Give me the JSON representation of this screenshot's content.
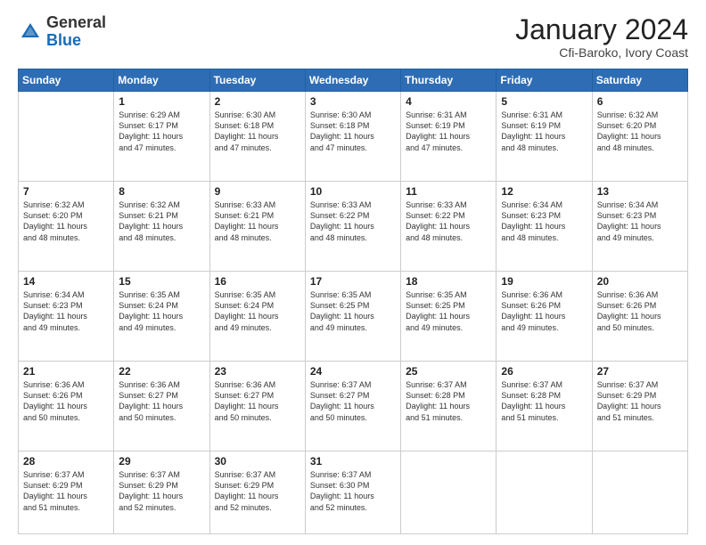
{
  "header": {
    "logo_general": "General",
    "logo_blue": "Blue",
    "month_title": "January 2024",
    "subtitle": "Cfi-Baroko, Ivory Coast"
  },
  "weekdays": [
    "Sunday",
    "Monday",
    "Tuesday",
    "Wednesday",
    "Thursday",
    "Friday",
    "Saturday"
  ],
  "weeks": [
    [
      {
        "day": "",
        "info": ""
      },
      {
        "day": "1",
        "info": "Sunrise: 6:29 AM\nSunset: 6:17 PM\nDaylight: 11 hours\nand 47 minutes."
      },
      {
        "day": "2",
        "info": "Sunrise: 6:30 AM\nSunset: 6:18 PM\nDaylight: 11 hours\nand 47 minutes."
      },
      {
        "day": "3",
        "info": "Sunrise: 6:30 AM\nSunset: 6:18 PM\nDaylight: 11 hours\nand 47 minutes."
      },
      {
        "day": "4",
        "info": "Sunrise: 6:31 AM\nSunset: 6:19 PM\nDaylight: 11 hours\nand 47 minutes."
      },
      {
        "day": "5",
        "info": "Sunrise: 6:31 AM\nSunset: 6:19 PM\nDaylight: 11 hours\nand 48 minutes."
      },
      {
        "day": "6",
        "info": "Sunrise: 6:32 AM\nSunset: 6:20 PM\nDaylight: 11 hours\nand 48 minutes."
      }
    ],
    [
      {
        "day": "7",
        "info": "Sunrise: 6:32 AM\nSunset: 6:20 PM\nDaylight: 11 hours\nand 48 minutes."
      },
      {
        "day": "8",
        "info": "Sunrise: 6:32 AM\nSunset: 6:21 PM\nDaylight: 11 hours\nand 48 minutes."
      },
      {
        "day": "9",
        "info": "Sunrise: 6:33 AM\nSunset: 6:21 PM\nDaylight: 11 hours\nand 48 minutes."
      },
      {
        "day": "10",
        "info": "Sunrise: 6:33 AM\nSunset: 6:22 PM\nDaylight: 11 hours\nand 48 minutes."
      },
      {
        "day": "11",
        "info": "Sunrise: 6:33 AM\nSunset: 6:22 PM\nDaylight: 11 hours\nand 48 minutes."
      },
      {
        "day": "12",
        "info": "Sunrise: 6:34 AM\nSunset: 6:23 PM\nDaylight: 11 hours\nand 48 minutes."
      },
      {
        "day": "13",
        "info": "Sunrise: 6:34 AM\nSunset: 6:23 PM\nDaylight: 11 hours\nand 49 minutes."
      }
    ],
    [
      {
        "day": "14",
        "info": "Sunrise: 6:34 AM\nSunset: 6:23 PM\nDaylight: 11 hours\nand 49 minutes."
      },
      {
        "day": "15",
        "info": "Sunrise: 6:35 AM\nSunset: 6:24 PM\nDaylight: 11 hours\nand 49 minutes."
      },
      {
        "day": "16",
        "info": "Sunrise: 6:35 AM\nSunset: 6:24 PM\nDaylight: 11 hours\nand 49 minutes."
      },
      {
        "day": "17",
        "info": "Sunrise: 6:35 AM\nSunset: 6:25 PM\nDaylight: 11 hours\nand 49 minutes."
      },
      {
        "day": "18",
        "info": "Sunrise: 6:35 AM\nSunset: 6:25 PM\nDaylight: 11 hours\nand 49 minutes."
      },
      {
        "day": "19",
        "info": "Sunrise: 6:36 AM\nSunset: 6:26 PM\nDaylight: 11 hours\nand 49 minutes."
      },
      {
        "day": "20",
        "info": "Sunrise: 6:36 AM\nSunset: 6:26 PM\nDaylight: 11 hours\nand 50 minutes."
      }
    ],
    [
      {
        "day": "21",
        "info": "Sunrise: 6:36 AM\nSunset: 6:26 PM\nDaylight: 11 hours\nand 50 minutes."
      },
      {
        "day": "22",
        "info": "Sunrise: 6:36 AM\nSunset: 6:27 PM\nDaylight: 11 hours\nand 50 minutes."
      },
      {
        "day": "23",
        "info": "Sunrise: 6:36 AM\nSunset: 6:27 PM\nDaylight: 11 hours\nand 50 minutes."
      },
      {
        "day": "24",
        "info": "Sunrise: 6:37 AM\nSunset: 6:27 PM\nDaylight: 11 hours\nand 50 minutes."
      },
      {
        "day": "25",
        "info": "Sunrise: 6:37 AM\nSunset: 6:28 PM\nDaylight: 11 hours\nand 51 minutes."
      },
      {
        "day": "26",
        "info": "Sunrise: 6:37 AM\nSunset: 6:28 PM\nDaylight: 11 hours\nand 51 minutes."
      },
      {
        "day": "27",
        "info": "Sunrise: 6:37 AM\nSunset: 6:29 PM\nDaylight: 11 hours\nand 51 minutes."
      }
    ],
    [
      {
        "day": "28",
        "info": "Sunrise: 6:37 AM\nSunset: 6:29 PM\nDaylight: 11 hours\nand 51 minutes."
      },
      {
        "day": "29",
        "info": "Sunrise: 6:37 AM\nSunset: 6:29 PM\nDaylight: 11 hours\nand 52 minutes."
      },
      {
        "day": "30",
        "info": "Sunrise: 6:37 AM\nSunset: 6:29 PM\nDaylight: 11 hours\nand 52 minutes."
      },
      {
        "day": "31",
        "info": "Sunrise: 6:37 AM\nSunset: 6:30 PM\nDaylight: 11 hours\nand 52 minutes."
      },
      {
        "day": "",
        "info": ""
      },
      {
        "day": "",
        "info": ""
      },
      {
        "day": "",
        "info": ""
      }
    ]
  ]
}
